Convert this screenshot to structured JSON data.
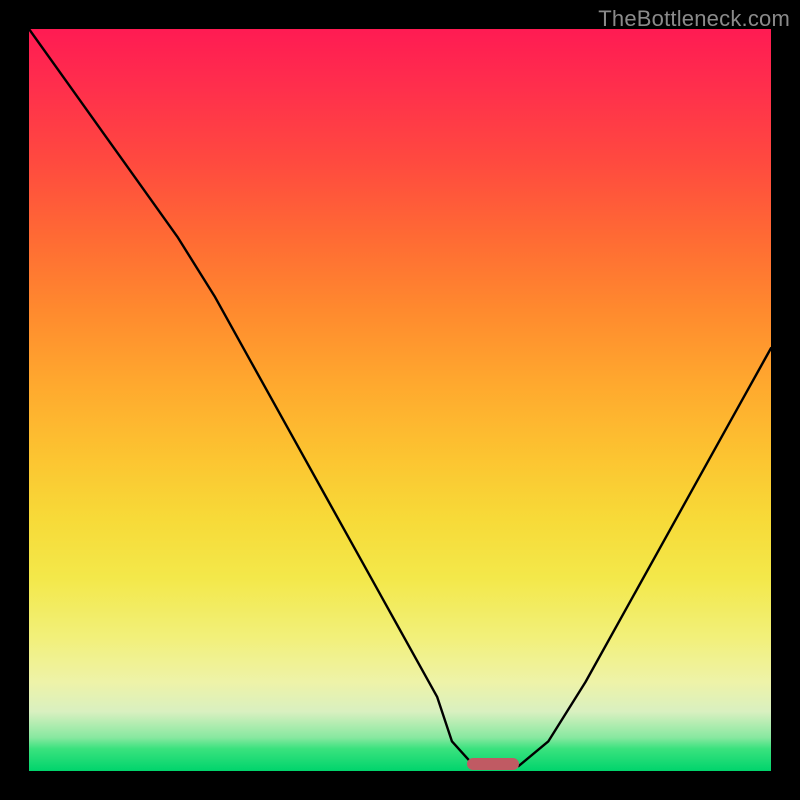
{
  "watermark": "TheBottleneck.com",
  "colors": {
    "frame": "#000000",
    "curve": "#000000",
    "marker": "#c05a63"
  },
  "chart_data": {
    "type": "line",
    "title": "",
    "xlabel": "",
    "ylabel": "",
    "xlim": [
      0,
      100
    ],
    "ylim": [
      0,
      100
    ],
    "x": [
      0,
      5,
      10,
      15,
      20,
      25,
      30,
      35,
      40,
      45,
      50,
      55,
      57,
      60,
      62,
      64,
      66,
      70,
      75,
      80,
      85,
      90,
      95,
      100
    ],
    "values": [
      100,
      93,
      86,
      79,
      72,
      64,
      55,
      46,
      37,
      28,
      19,
      10,
      4,
      0,
      0,
      0,
      0,
      4,
      12,
      21,
      30,
      39,
      48,
      57
    ],
    "marker": {
      "x_start": 59,
      "x_end": 66,
      "y": 0
    },
    "note": "x/y in percent of axis range; values estimated from pixel positions"
  }
}
